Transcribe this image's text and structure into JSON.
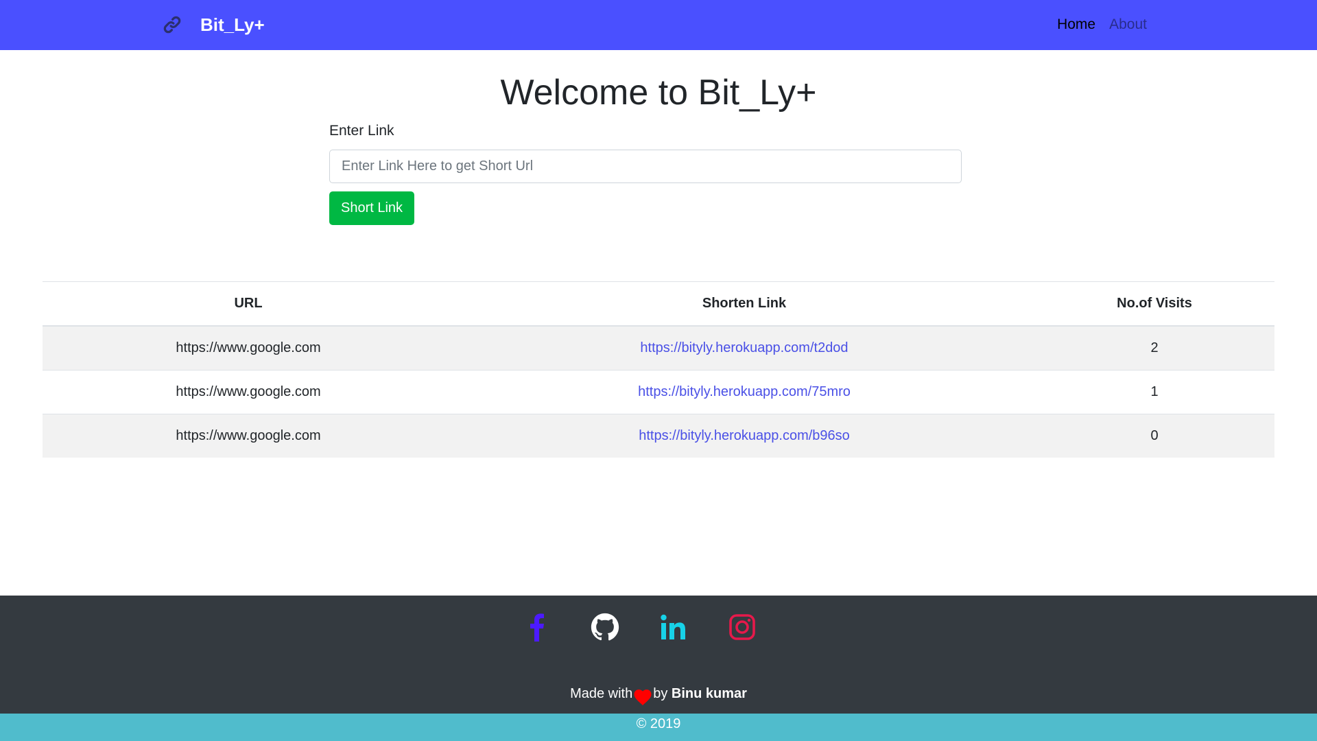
{
  "navbar": {
    "brand_text": "Bit_Ly+",
    "brand_icon": "link-icon",
    "links": [
      {
        "label": "Home"
      },
      {
        "label": "About"
      }
    ]
  },
  "main": {
    "title": "Welcome to Bit_Ly+",
    "form": {
      "label": "Enter Link",
      "placeholder": "Enter Link Here to get Short Url",
      "value": "",
      "button_label": "Short Link"
    }
  },
  "table": {
    "headers": [
      "URL",
      "Shorten Link",
      "No.of Visits"
    ],
    "rows": [
      {
        "url": "https://www.google.com",
        "short": "https://bityly.herokuapp.com/t2dod",
        "visits": "2"
      },
      {
        "url": "https://www.google.com",
        "short": "https://bityly.herokuapp.com/75mro",
        "visits": "1"
      },
      {
        "url": "https://www.google.com",
        "short": "https://bityly.herokuapp.com/b96so",
        "visits": "0"
      }
    ]
  },
  "footer": {
    "social_icons": [
      "facebook-icon",
      "github-icon",
      "linkedin-icon",
      "instagram-icon"
    ],
    "made_with_prefix": "Made with",
    "made_with_by": "by",
    "author": "Binu kumar",
    "copyright": "© 2019"
  },
  "colors": {
    "navbar": "#4a50ff",
    "button": "#00b843",
    "footer": "#343a40",
    "copyright_bar": "#50bccc",
    "link": "#4a50e6",
    "facebook": "#4c1aff",
    "linkedin": "#17d2e8",
    "instagram": "#e6194b",
    "heart": "#ff0000"
  }
}
